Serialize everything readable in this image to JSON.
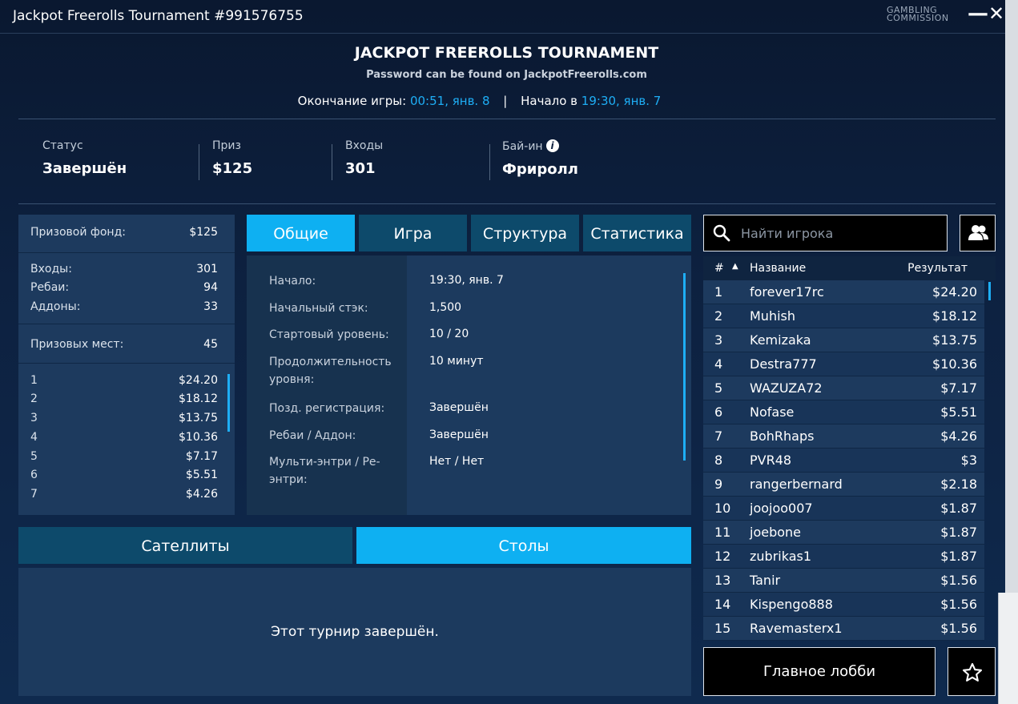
{
  "window": {
    "title": "Jackpot Freerolls Tournament #991576755",
    "logo_line1": "GAMBLING",
    "logo_line2": "COMMISSION",
    "minimize": "—",
    "close": "✕"
  },
  "header": {
    "title": "JACKPOT FREEROLLS TOURNAMENT",
    "subtitle": "Password can be found on JackpotFreerolls.com",
    "end_label": "Окончание игры:",
    "end_value": "00:51, янв. 8",
    "separator": "|",
    "start_label": "Начало в",
    "start_value": "19:30, янв. 7"
  },
  "stats": {
    "status_label": "Статус",
    "status_value": "Завершён",
    "prize_label": "Приз",
    "prize_value": "$125",
    "entries_label": "Входы",
    "entries_value": "301",
    "buyin_label": "Бай-ин",
    "buyin_value": "Фриролл",
    "info_icon": "i"
  },
  "prize_panel": {
    "pool_label": "Призовой фонд:",
    "pool_value": "$125",
    "entries_label": "Входы:",
    "entries_value": "301",
    "rebuys_label": "Ребаи:",
    "rebuys_value": "94",
    "addons_label": "Аддоны:",
    "addons_value": "33",
    "places_label": "Призовых мест:",
    "places_value": "45",
    "places": [
      {
        "place": "1",
        "amount": "$24.20"
      },
      {
        "place": "2",
        "amount": "$18.12"
      },
      {
        "place": "3",
        "amount": "$13.75"
      },
      {
        "place": "4",
        "amount": "$10.36"
      },
      {
        "place": "5",
        "amount": "$7.17"
      },
      {
        "place": "6",
        "amount": "$5.51"
      },
      {
        "place": "7",
        "amount": "$4.26"
      }
    ]
  },
  "tabs": [
    "Общие",
    "Игра",
    "Структура",
    "Статистика"
  ],
  "details": [
    {
      "label": "Начало:",
      "value": "19:30, янв. 7"
    },
    {
      "label": "Начальный стэк:",
      "value": "1,500"
    },
    {
      "label": "Стартовый уровень:",
      "value": "10 / 20"
    },
    {
      "label": "Продолжительность уровня:",
      "value": "10 минут"
    },
    {
      "label": "Позд. регистрация:",
      "value": "Завершён"
    },
    {
      "label": "Ребаи / Аддон:",
      "value": "Завершён"
    },
    {
      "label": "Мульти-энтри / Ре-энтри:",
      "value": "Нет / Нет"
    }
  ],
  "bottom_tabs": {
    "satellites": "Сателлиты",
    "tables": "Столы"
  },
  "finished_message": "Этот турнир завершён.",
  "search": {
    "placeholder": "Найти игрока"
  },
  "leaderboard": {
    "col_num": "#",
    "sort_indicator": "▲",
    "col_name": "Название",
    "col_result": "Результат",
    "rows": [
      {
        "n": "1",
        "name": "forever17rc",
        "result": "$24.20"
      },
      {
        "n": "2",
        "name": "Muhish",
        "result": "$18.12"
      },
      {
        "n": "3",
        "name": "Kemizaka",
        "result": "$13.75"
      },
      {
        "n": "4",
        "name": "Destra777",
        "result": "$10.36"
      },
      {
        "n": "5",
        "name": "WAZUZA72",
        "result": "$7.17"
      },
      {
        "n": "6",
        "name": "Nofase",
        "result": "$5.51"
      },
      {
        "n": "7",
        "name": "BohRhaps",
        "result": "$4.26"
      },
      {
        "n": "8",
        "name": "PVR48",
        "result": "$3"
      },
      {
        "n": "9",
        "name": "rangerbernard",
        "result": "$2.18"
      },
      {
        "n": "10",
        "name": "joojoo007",
        "result": "$1.87"
      },
      {
        "n": "11",
        "name": "joebone",
        "result": "$1.87"
      },
      {
        "n": "12",
        "name": "zubrikas1",
        "result": "$1.87"
      },
      {
        "n": "13",
        "name": "Tanir",
        "result": "$1.56"
      },
      {
        "n": "14",
        "name": "Kispengo888",
        "result": "$1.56"
      },
      {
        "n": "15",
        "name": "Ravemasterx1",
        "result": "$1.56"
      }
    ]
  },
  "lobby_button": "Главное лобби",
  "colors": {
    "accent": "#0eb0f2",
    "highlight_text": "#1eaef5",
    "tab_inactive": "#0d4a6b",
    "panel": "#1d3a5e"
  },
  "icons": {
    "search": "search-icon",
    "friends": "users-icon",
    "favorite": "star-icon",
    "info": "info-icon"
  }
}
